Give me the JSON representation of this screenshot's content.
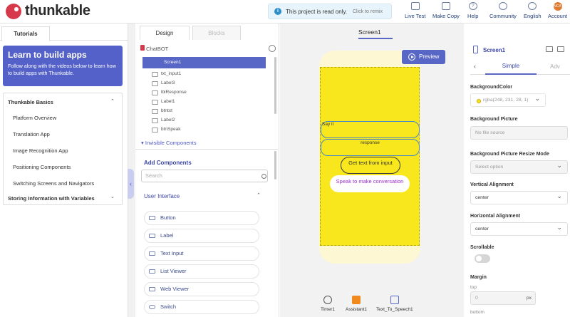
{
  "brand": {
    "name": "thunkable"
  },
  "notice": {
    "icon": "info-icon",
    "text": "This project is read only.",
    "action": "Click to remix"
  },
  "nav": [
    {
      "label": "Live Test",
      "icon": "phone-icon"
    },
    {
      "label": "Make Copy",
      "icon": "copy-icon"
    },
    {
      "label": "Help",
      "icon": "help-icon"
    },
    {
      "label": "Community",
      "icon": "community-icon"
    },
    {
      "label": "English",
      "icon": "globe-icon"
    },
    {
      "label": "Account",
      "icon": "avatar-icon",
      "avatar_text": "NCA"
    }
  ],
  "left": {
    "tab": "Tutorials",
    "learn": {
      "title": "Learn to build apps",
      "desc": "Follow along with the videos below to learn how to build apps with Thunkable."
    },
    "sections": [
      {
        "title": "Thunkable Basics",
        "expanded": true,
        "items": [
          "Platform Overview",
          "Translation App",
          "Image Recognition App",
          "Positioning Components",
          "Switching Screens and Navigators"
        ]
      },
      {
        "title": "Storing Information with Variables",
        "expanded": false,
        "items": []
      }
    ]
  },
  "middle": {
    "tabs": [
      "Design",
      "Blocks"
    ],
    "project": "ChatBOT",
    "tree": {
      "selected": "Screen1",
      "children": [
        "txt_input1",
        "Label3",
        "lblResponse",
        "Label1",
        "btntxt",
        "Label2",
        "btnSpeak"
      ]
    },
    "invisible_label": "Invisible Components",
    "add_components": "Add Components",
    "search_placeholder": "Search",
    "ui_section": "User Interface",
    "components": [
      "Button",
      "Label",
      "Text Input",
      "List Viewer",
      "Web Viewer",
      "Switch"
    ]
  },
  "canvas": {
    "screen_name": "Screen1",
    "preview": "Preview",
    "field1": "Say it",
    "field2": "response",
    "button1": "Get text from input",
    "button2": "Speak to make conversation",
    "nonvisible": [
      {
        "label": "Timer1",
        "icon": "timer-icon"
      },
      {
        "label": "Assistant1",
        "icon": "cube-icon"
      },
      {
        "label": "Text_To_Speech1",
        "icon": "speech-icon"
      }
    ],
    "colors": {
      "screen_bg": "#f8e71c",
      "accent": "#5866c6",
      "button2_text": "#9b2bc9"
    }
  },
  "properties": {
    "title": "Screen1",
    "tabs": [
      "Simple",
      "Adv"
    ],
    "background_color_label": "BackgroundColor",
    "background_color_value": "rgba(248, 231, 28, 1)",
    "background_picture_label": "Background Picture",
    "background_picture_value": "No file source",
    "resize_label": "Background Picture Resize Mode",
    "resize_value": "Select option",
    "valign_label": "Vertical Alignment",
    "valign_value": "center",
    "halign_label": "Horizontal Alignment",
    "halign_value": "center",
    "scrollable_label": "Scrollable",
    "margin_label": "Margin",
    "top_label": "top",
    "top_value": "0",
    "top_unit": "px",
    "bottom_label": "bottom"
  }
}
